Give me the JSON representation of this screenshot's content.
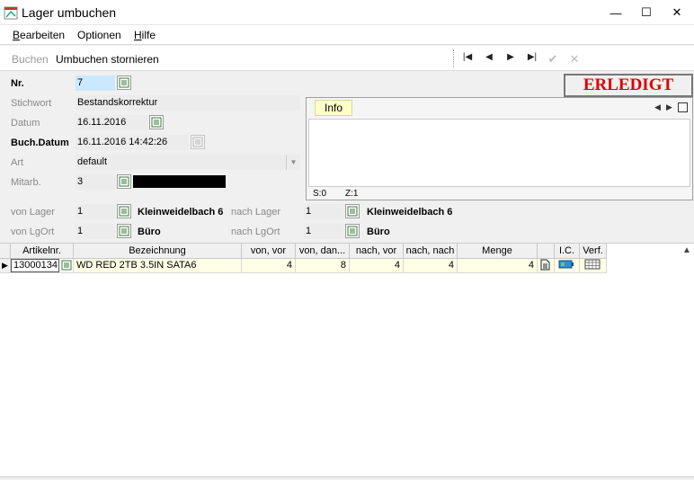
{
  "window": {
    "title": "Lager umbuchen",
    "minimize": "—",
    "maximize": "☐",
    "close": "✕"
  },
  "menu": {
    "items": [
      {
        "first": "B",
        "rest": "earbeiten"
      },
      {
        "first": "",
        "rest": "Optionen"
      },
      {
        "first": "H",
        "rest": "ilfe"
      }
    ]
  },
  "toolbar": {
    "buchen": "Buchen",
    "stornieren": "Umbuchen stornieren",
    "first": "|◀",
    "prev": "◀",
    "next": "▶",
    "last": "▶|",
    "confirm": "✔",
    "cancel": "✕"
  },
  "form": {
    "nr_label": "Nr.",
    "nr_value": "7",
    "stichwort_label": "Stichwort",
    "stichwort_value": "Bestandskorrektur",
    "datum_label": "Datum",
    "datum_value": "16.11.2016",
    "buchdatum_label": "Buch.Datum",
    "buchdatum_value": "16.11.2016 14:42:26",
    "art_label": "Art",
    "art_value": "default",
    "mitarb_label": "Mitarb.",
    "mitarb_value": "3",
    "von_lager_label": "von Lager",
    "von_lager_value": "1",
    "von_lager_name": "Kleinweidelbach 6",
    "nach_lager_label": "nach Lager",
    "nach_lager_value": "1",
    "nach_lager_name": "Kleinweidelbach 6",
    "von_lgort_label": "von LgOrt",
    "von_lgort_value": "1",
    "von_lgort_name": "Büro",
    "nach_lgort_label": "nach LgOrt",
    "nach_lgort_value": "1",
    "nach_lgort_name": "Büro"
  },
  "status": "ERLEDIGT",
  "info": {
    "tab": "Info",
    "s": "S:0",
    "z": "Z:1"
  },
  "grid": {
    "headers": [
      "Artikelnr.",
      "Bezeichnung",
      "von, vor",
      "von, dan...",
      "nach, vor",
      "nach, nach",
      "Menge",
      "",
      "I.C.",
      "Verf."
    ],
    "row": {
      "artikelnr": "13000134",
      "bezeichnung": "WD RED 2TB 3.5IN SATA6",
      "von_vor": "4",
      "von_dan": "8",
      "nach_vor": "4",
      "nach_nach": "4",
      "menge": "4"
    }
  },
  "colors": {
    "status_red": "#e00000",
    "selection_blue": "#cce8ff",
    "row_yellow": "#ffffe6",
    "info_tab_yellow": "#ffffc8"
  }
}
